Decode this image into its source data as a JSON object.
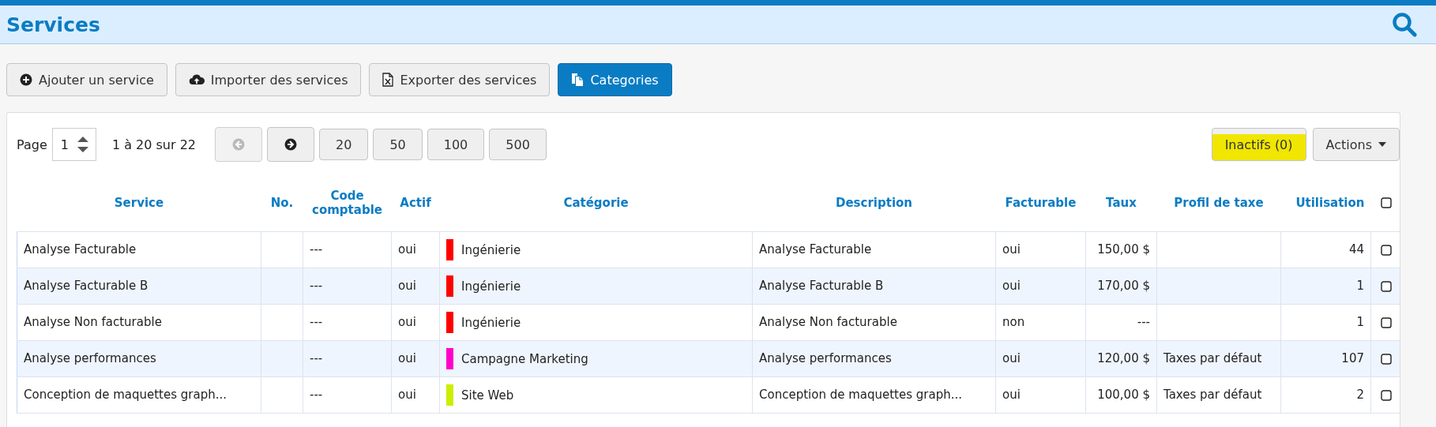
{
  "header": {
    "title": "Services"
  },
  "toolbar": [
    {
      "label": "Ajouter un service",
      "primary": false
    },
    {
      "label": "Importer des services",
      "primary": false
    },
    {
      "label": "Exporter des services",
      "primary": false
    },
    {
      "label": "Categories",
      "primary": true
    }
  ],
  "pagination": {
    "label": "Page",
    "page": "1",
    "range": "1 à 20 sur 22",
    "prev_disabled": true,
    "next_disabled": false,
    "sizes": [
      "20",
      "50",
      "100",
      "500"
    ]
  },
  "filters": {
    "inactive": {
      "label": "Inactifs (0)",
      "highlighted": true
    },
    "actions": {
      "label": "Actions"
    }
  },
  "table": {
    "columns": [
      {
        "label": "Service"
      },
      {
        "label": "No."
      },
      {
        "label": "Code comptable"
      },
      {
        "label": "Actif"
      },
      {
        "label": "Catégorie"
      },
      {
        "label": "Description"
      },
      {
        "label": "Facturable"
      },
      {
        "label": "Taux"
      },
      {
        "label": "Profil de taxe"
      },
      {
        "label": "Utilisation"
      }
    ],
    "select_all": false,
    "rows": [
      {
        "service": "Analyse Facturable",
        "code": "---",
        "active": "oui",
        "category": "Ingénierie",
        "color": "#ff0000",
        "description": "Analyse Facturable",
        "billable": "oui",
        "rate": "150,00 $",
        "usage": "44",
        "checked": false
      },
      {
        "service": "Analyse Facturable B",
        "code": "---",
        "active": "oui",
        "category": "Ingénierie",
        "color": "#ff0000",
        "description": "Analyse Facturable B",
        "billable": "oui",
        "rate": "170,00 $",
        "usage": "1",
        "checked": false
      },
      {
        "service": "Analyse Non facturable",
        "code": "---",
        "active": "oui",
        "category": "Ingénierie",
        "color": "#ff0000",
        "description": "Analyse Non facturable",
        "billable": "non",
        "rate": "---",
        "usage": "1",
        "checked": false
      },
      {
        "service": "Analyse performances",
        "code": "---",
        "active": "oui",
        "category": "Campagne Marketing",
        "color": "#ff00cc",
        "description": "Analyse performances",
        "billable": "oui",
        "rate": "120,00 $",
        "tax_profile": "Taxes par défaut",
        "usage": "107",
        "checked": false
      },
      {
        "service": "Conception de maquettes graph...",
        "code": "---",
        "active": "oui",
        "category": "Site Web",
        "color": "#ccee00",
        "description": "Conception de maquettes graph...",
        "billable": "oui",
        "rate": "100,00 $",
        "tax_profile": "Taxes par défaut",
        "usage": "2",
        "checked": false
      }
    ]
  }
}
